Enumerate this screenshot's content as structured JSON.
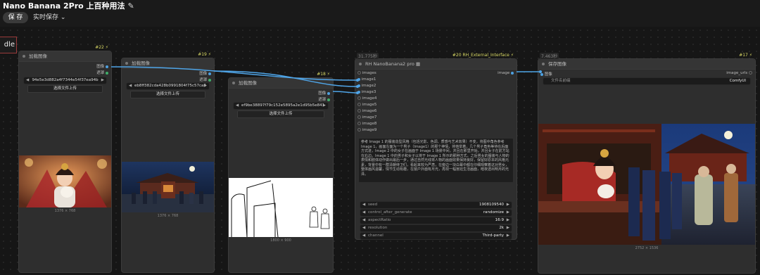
{
  "header": {
    "title": "Nano Banana 2Pro 上百种用法",
    "save_label": "保 存",
    "realtime_save_label": "实时保存",
    "realtime_chevron": "⌄"
  },
  "corner_tab": "dle",
  "nodes": {
    "n22": {
      "id": "#22",
      "title": "加载图像",
      "outputs": [
        "图像",
        "遮罩"
      ],
      "filename": "94e5e3d882a4f7344e54f37ea94b",
      "upload_label": "选择文件上传",
      "dims": "1376 × 768"
    },
    "n19": {
      "id": "#19",
      "title": "加载图像",
      "outputs": [
        "图像",
        "遮罩"
      ],
      "filename": "eb8ff382cda428b0991804f75c57ca3",
      "upload_label": "选择文件上传",
      "dims": "1376 × 768"
    },
    "n18": {
      "id": "#18",
      "title": "加载图像",
      "outputs": [
        "图像",
        "遮罩"
      ],
      "filename": "ef9be38897f79c152e5895a2e1d95b5e841",
      "upload_label": "选择文件上传",
      "dims": "1800 × 900"
    },
    "n20": {
      "id": "#20 RH_External_Interface",
      "time": "31.775秒",
      "title": "RH NanoBanana2 pro",
      "inputs": [
        "images",
        "image1",
        "image2",
        "image3",
        "image4",
        "image5",
        "image6",
        "image7",
        "image8",
        "image9"
      ],
      "output": "image",
      "prompt": "参考 Image 1 的服装造型风格（包括光影、色调、质感与艺术效果）不变，将图中角色参考 Image 1，画面左面为一个男子（Image1）的那个神情，将他举着，几个男子角色等待在后面方式进，Image 2 中的女子在画面于 Image 1 场景中间，并且在那里开始，并且女子在前方站在右边。Image 1 中的男子和女子以将于 Image 1 所示的那种方式，之后男女的服装与人物的表情和肢体动作做出最后一步，通过自然光线将人物的画面效果保持良好，保留好原本的风格元素，背景中有一群清朝侍卫们，看起来较为严肃，在旁边一块白幕中都在仔细观察着这对男女，整体画风温馨，情节生动有趣，在窗户外面有月光，再现一幅宫廷生活画面，暗夜透出明月的光泽。",
      "widgets": [
        {
          "label": "seed",
          "value": "1908109540"
        },
        {
          "label": "control_after_generate",
          "value": "randomize"
        },
        {
          "label": "aspectRatio",
          "value": "16:9"
        },
        {
          "label": "resolution",
          "value": "2k"
        },
        {
          "label": "channel",
          "value": "Third-party"
        }
      ]
    },
    "n17": {
      "id": "#17",
      "time": "7.463秒",
      "title": "保存图像",
      "input": "图像",
      "output": "image_urls",
      "field_label": "文件名前缀",
      "field_value": "ComfyUI",
      "dims": "2752 × 1536"
    }
  },
  "icons": {
    "edit": "pencil-icon",
    "chevron": "chevron-down-icon",
    "node_badge": "lightning-icon"
  }
}
